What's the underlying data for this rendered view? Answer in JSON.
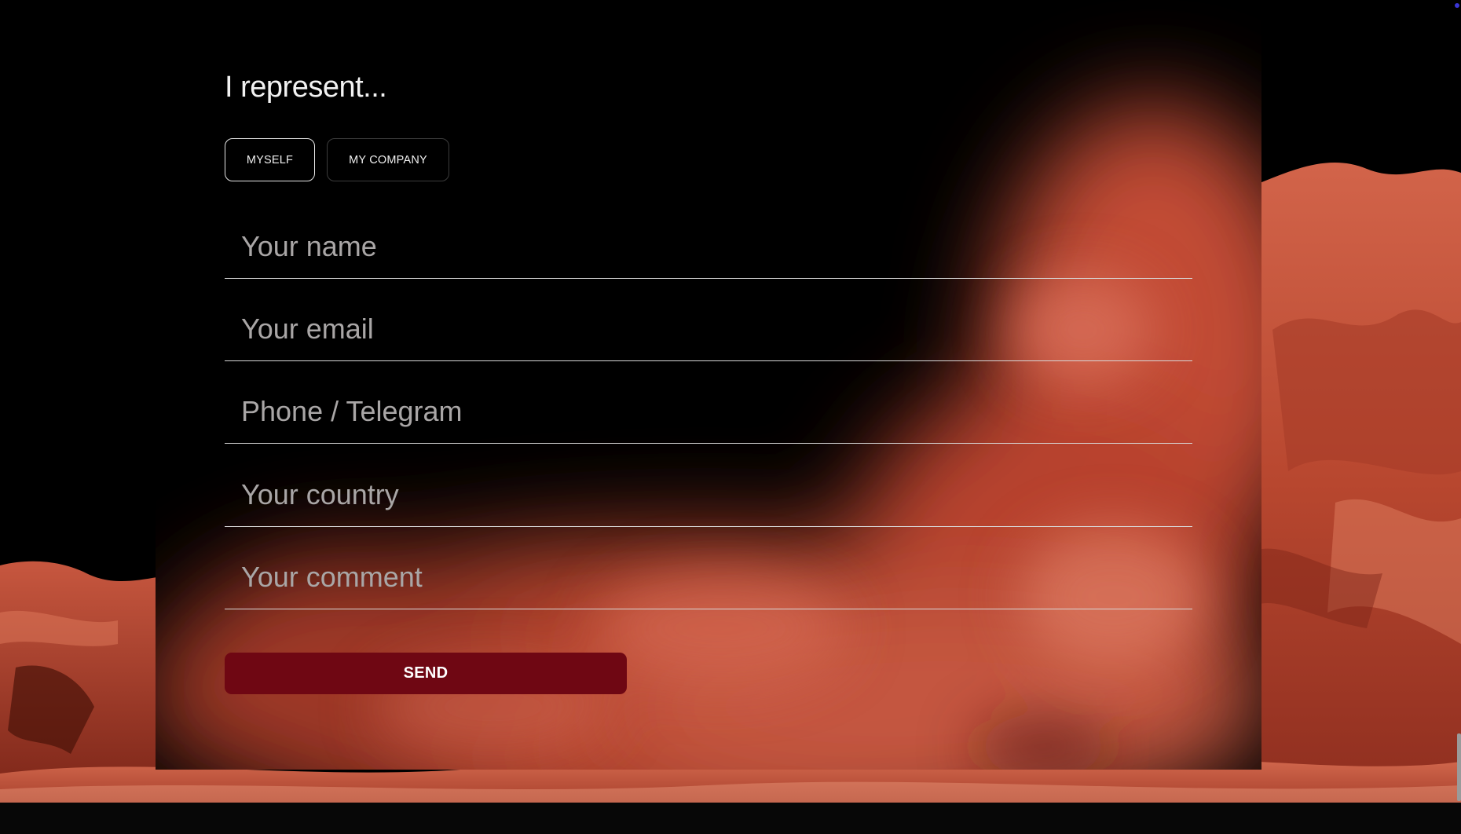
{
  "heading": "I represent...",
  "toggles": {
    "myself": "MYSELF",
    "company": "MY COMPANY",
    "selected": "myself"
  },
  "fields": {
    "name": {
      "placeholder": "Your name",
      "value": ""
    },
    "email": {
      "placeholder": "Your email",
      "value": ""
    },
    "phone": {
      "placeholder": "Phone / Telegram",
      "value": ""
    },
    "country": {
      "placeholder": "Your country",
      "value": ""
    },
    "comment": {
      "placeholder": "Your comment",
      "value": ""
    }
  },
  "send_label": "SEND",
  "colors": {
    "background": "#000000",
    "send_button": "#6f0713",
    "desert": "#c8553e",
    "placeholder": "#a9a6a6",
    "underline": "#d8d8d8"
  },
  "icons": {
    "scroll": "scrollbar-thumb",
    "indicator": "status-dot"
  }
}
